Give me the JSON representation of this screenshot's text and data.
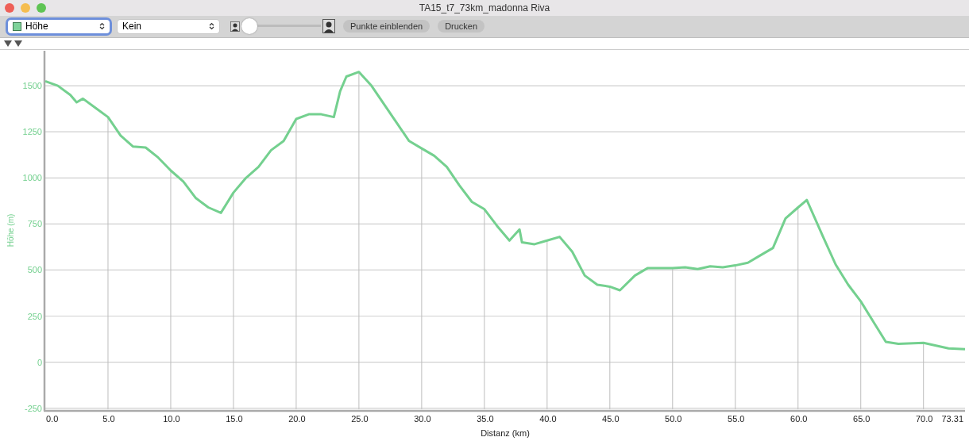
{
  "window": {
    "title": "TA15_t7_73km_madonna Riva"
  },
  "toolbar": {
    "metric_select": {
      "value": "Höhe"
    },
    "overlay_select": {
      "value": "Kein"
    },
    "zoom_slider": {
      "level": 0
    },
    "buttons": [
      "Punkte einblenden",
      "Drucken"
    ]
  },
  "chart": {
    "chart_data": {
      "type": "line",
      "grid": true,
      "ref_lines": [
        {
          "axis": "x",
          "value": 5
        },
        {
          "axis": "x",
          "value": 10
        },
        {
          "axis": "x",
          "value": 15
        },
        {
          "axis": "x",
          "value": 20
        },
        {
          "axis": "x",
          "value": 25
        },
        {
          "axis": "x",
          "value": 30
        },
        {
          "axis": "x",
          "value": 35
        },
        {
          "axis": "x",
          "value": 40
        },
        {
          "axis": "x",
          "value": 45
        },
        {
          "axis": "x",
          "value": 50
        },
        {
          "axis": "x",
          "value": 55
        },
        {
          "axis": "x",
          "value": 60
        },
        {
          "axis": "x",
          "value": 65
        },
        {
          "axis": "x",
          "value": 70
        }
      ],
      "xlabel": "Distanz (km)",
      "ylabel": "Höhe (m)",
      "xlim": [
        0,
        73.31
      ],
      "ylim": [
        -260,
        1690
      ],
      "xticks": [
        {
          "value": 0,
          "label": "0.0"
        },
        {
          "value": 5,
          "label": "5.0"
        },
        {
          "value": 10,
          "label": "10.0"
        },
        {
          "value": 15,
          "label": "15.0"
        },
        {
          "value": 20,
          "label": "20.0"
        },
        {
          "value": 25,
          "label": "25.0"
        },
        {
          "value": 30,
          "label": "30.0"
        },
        {
          "value": 35,
          "label": "35.0"
        },
        {
          "value": 40,
          "label": "40.0"
        },
        {
          "value": 45,
          "label": "45.0"
        },
        {
          "value": 50,
          "label": "50.0"
        },
        {
          "value": 55,
          "label": "55.0"
        },
        {
          "value": 60,
          "label": "60.0"
        },
        {
          "value": 65,
          "label": "65.0"
        },
        {
          "value": 70,
          "label": "70.0"
        },
        {
          "value": 73.31,
          "label": "73.31"
        }
      ],
      "yticks": [
        -250,
        0,
        250,
        500,
        750,
        1000,
        1250,
        1500
      ],
      "x": [
        0,
        1,
        2,
        2.5,
        3,
        4,
        5,
        6,
        7,
        8,
        9,
        10,
        11,
        12,
        13,
        14,
        15,
        16,
        17,
        18,
        19,
        20,
        21,
        22,
        23,
        23.5,
        24,
        25,
        26,
        27,
        28,
        29,
        30,
        31,
        32,
        33,
        34,
        35,
        36,
        37,
        37.8,
        38,
        39,
        40,
        41,
        42,
        43,
        44,
        45,
        45.8,
        47,
        48,
        50,
        51,
        52,
        53,
        54,
        55,
        56,
        57,
        58,
        59,
        60,
        60.7,
        62,
        63,
        64,
        65,
        66,
        67,
        68,
        70,
        71,
        72,
        73.31
      ],
      "series": [
        {
          "color": "#74d08f",
          "values": [
            1525,
            1500,
            1450,
            1410,
            1430,
            1380,
            1330,
            1230,
            1170,
            1165,
            1110,
            1040,
            980,
            890,
            840,
            810,
            920,
            1000,
            1060,
            1150,
            1200,
            1320,
            1345,
            1345,
            1330,
            1470,
            1550,
            1575,
            1500,
            1400,
            1300,
            1200,
            1160,
            1120,
            1060,
            960,
            870,
            830,
            740,
            660,
            720,
            650,
            640,
            660,
            680,
            600,
            470,
            420,
            410,
            390,
            470,
            510,
            510,
            515,
            505,
            520,
            515,
            525,
            540,
            580,
            620,
            780,
            840,
            880,
            680,
            530,
            420,
            330,
            220,
            110,
            100,
            105,
            90,
            75,
            70
          ]
        }
      ]
    }
  }
}
